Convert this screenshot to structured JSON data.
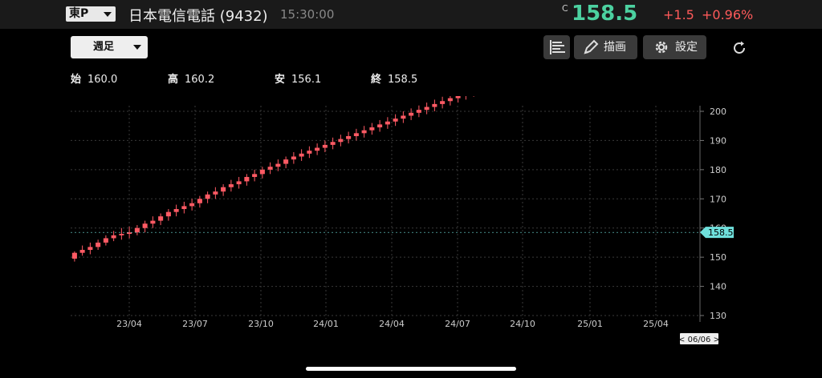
{
  "header": {
    "market": "東P",
    "name": "日本電信電話 (9432)",
    "time": "15:30:00",
    "c_mark": "C",
    "price": "158.5",
    "change": "+1.5",
    "change_pct": "+0.96%"
  },
  "toolbar": {
    "period": "週足",
    "draw_label": "描画",
    "settings_label": "設定"
  },
  "ohlc": {
    "open_label": "始",
    "open": "160.0",
    "high_label": "高",
    "high": "160.2",
    "low_label": "安",
    "low": "156.1",
    "close_label": "終",
    "close": "158.5"
  },
  "colors": {
    "up": "#ff5a64",
    "down": "#6fe0dc",
    "price": "#4cd1a0",
    "change": "#ff5a5a"
  },
  "chart_data": {
    "type": "candlestick",
    "y_ticks": [
      130,
      140,
      150,
      160,
      170,
      180,
      190,
      200
    ],
    "ylim": [
      125,
      202
    ],
    "x_labels": [
      "23/04",
      "23/07",
      "23/10",
      "24/01",
      "24/04",
      "24/07",
      "24/10",
      "25/01",
      "25/04"
    ],
    "current_price_label": "158.5",
    "date_cursor": "< 06/06 >",
    "candles": [
      [
        149.5,
        152.0,
        148.5,
        151.5
      ],
      [
        151.5,
        154.0,
        150.5,
        152.5
      ],
      [
        152.5,
        155.0,
        151.0,
        153.5
      ],
      [
        153.5,
        156.0,
        152.5,
        155.0
      ],
      [
        155.0,
        157.5,
        154.0,
        156.5
      ],
      [
        156.5,
        159.0,
        155.5,
        157.5
      ],
      [
        157.5,
        160.0,
        156.0,
        158.0
      ],
      [
        158.0,
        160.5,
        156.5,
        158.5
      ],
      [
        158.5,
        161.0,
        157.5,
        160.0
      ],
      [
        160.0,
        162.5,
        158.5,
        161.5
      ],
      [
        161.5,
        164.0,
        160.0,
        162.5
      ],
      [
        162.5,
        165.0,
        161.0,
        164.0
      ],
      [
        164.0,
        166.5,
        162.5,
        165.5
      ],
      [
        165.5,
        168.0,
        164.0,
        166.5
      ],
      [
        166.5,
        169.0,
        165.0,
        167.5
      ],
      [
        167.5,
        170.0,
        166.0,
        168.5
      ],
      [
        168.5,
        171.0,
        167.0,
        170.0
      ],
      [
        170.0,
        172.5,
        168.5,
        171.5
      ],
      [
        171.5,
        174.0,
        170.0,
        172.5
      ],
      [
        172.5,
        175.0,
        171.0,
        174.0
      ],
      [
        174.0,
        176.5,
        172.5,
        175.0
      ],
      [
        175.0,
        177.5,
        173.5,
        176.0
      ],
      [
        176.0,
        178.5,
        174.5,
        177.5
      ],
      [
        177.5,
        180.0,
        176.0,
        178.5
      ],
      [
        178.5,
        181.0,
        177.0,
        180.0
      ],
      [
        180.0,
        182.5,
        178.5,
        181.0
      ],
      [
        181.0,
        183.5,
        179.5,
        182.0
      ],
      [
        182.0,
        184.5,
        180.5,
        183.5
      ],
      [
        183.5,
        186.0,
        182.0,
        184.5
      ],
      [
        184.5,
        187.0,
        183.0,
        185.5
      ],
      [
        185.5,
        188.0,
        184.0,
        186.5
      ],
      [
        186.5,
        189.0,
        185.0,
        187.5
      ],
      [
        187.5,
        190.0,
        186.0,
        188.5
      ],
      [
        188.5,
        191.0,
        187.0,
        189.5
      ],
      [
        189.5,
        192.0,
        188.0,
        190.5
      ],
      [
        190.5,
        193.0,
        189.0,
        191.5
      ],
      [
        191.5,
        194.0,
        190.0,
        192.5
      ],
      [
        192.5,
        195.0,
        191.0,
        193.5
      ],
      [
        193.5,
        196.0,
        192.0,
        194.5
      ],
      [
        194.5,
        197.0,
        193.0,
        195.5
      ],
      [
        195.5,
        198.0,
        194.0,
        196.5
      ],
      [
        196.5,
        199.0,
        195.0,
        197.5
      ],
      [
        197.5,
        200.0,
        196.0,
        198.5
      ],
      [
        198.5,
        201.0,
        197.0,
        199.5
      ],
      [
        199.5,
        202.0,
        198.0,
        200.5
      ],
      [
        200.5,
        203.0,
        199.0,
        201.5
      ],
      [
        201.5,
        204.0,
        200.0,
        202.5
      ],
      [
        202.5,
        205.0,
        201.0,
        203.5
      ],
      [
        203.5,
        206.0,
        202.0,
        204.5
      ],
      [
        204.5,
        207.0,
        203.0,
        205.5
      ],
      [
        205.5,
        208.0,
        204.0,
        206.5
      ],
      [
        206.5,
        209.0,
        205.0,
        207.5
      ],
      [
        207.5,
        210.0,
        206.0,
        208.5
      ],
      [
        208.5,
        211.0,
        207.0,
        209.5
      ],
      [
        209.5,
        212.0,
        208.0,
        210.5
      ],
      [
        210.5,
        213.0,
        209.0,
        211.5
      ],
      [
        211.5,
        214.0,
        210.0,
        212.5
      ],
      [
        212.5,
        215.0,
        211.0,
        213.5
      ],
      [
        213.5,
        216.0,
        212.0,
        214.5
      ],
      [
        214.5,
        217.0,
        213.0,
        215.5
      ],
      [
        215.5,
        218.0,
        214.0,
        216.5
      ],
      [
        216.5,
        219.0,
        215.0,
        217.5
      ],
      [
        217.5,
        220.0,
        216.0,
        218.5
      ],
      [
        218.5,
        221.0,
        217.0,
        219.5
      ],
      [
        219.5,
        222.0,
        218.0,
        220.5
      ],
      [
        220.5,
        223.0,
        219.0,
        221.5
      ],
      [
        221.5,
        224.0,
        220.0,
        222.5
      ],
      [
        222.5,
        225.0,
        221.0,
        223.5
      ],
      [
        223.5,
        226.0,
        222.0,
        224.5
      ],
      [
        224.5,
        227.0,
        223.0,
        225.5
      ],
      [
        225.5,
        228.0,
        224.0,
        226.5
      ],
      [
        226.5,
        229.0,
        225.0,
        227.5
      ],
      [
        227.5,
        230.0,
        226.0,
        228.5
      ],
      [
        228.5,
        231.0,
        227.0,
        229.5
      ],
      [
        229.5,
        232.0,
        228.0,
        230.5
      ],
      [
        230.5,
        233.0,
        229.0,
        231.5
      ],
      [
        231.5,
        234.0,
        230.0,
        232.5
      ],
      [
        232.5,
        235.0,
        231.0,
        233.5
      ],
      [
        233.5,
        236.0,
        232.0,
        234.5
      ],
      [
        234.5,
        237.0,
        233.0,
        235.5
      ]
    ]
  }
}
